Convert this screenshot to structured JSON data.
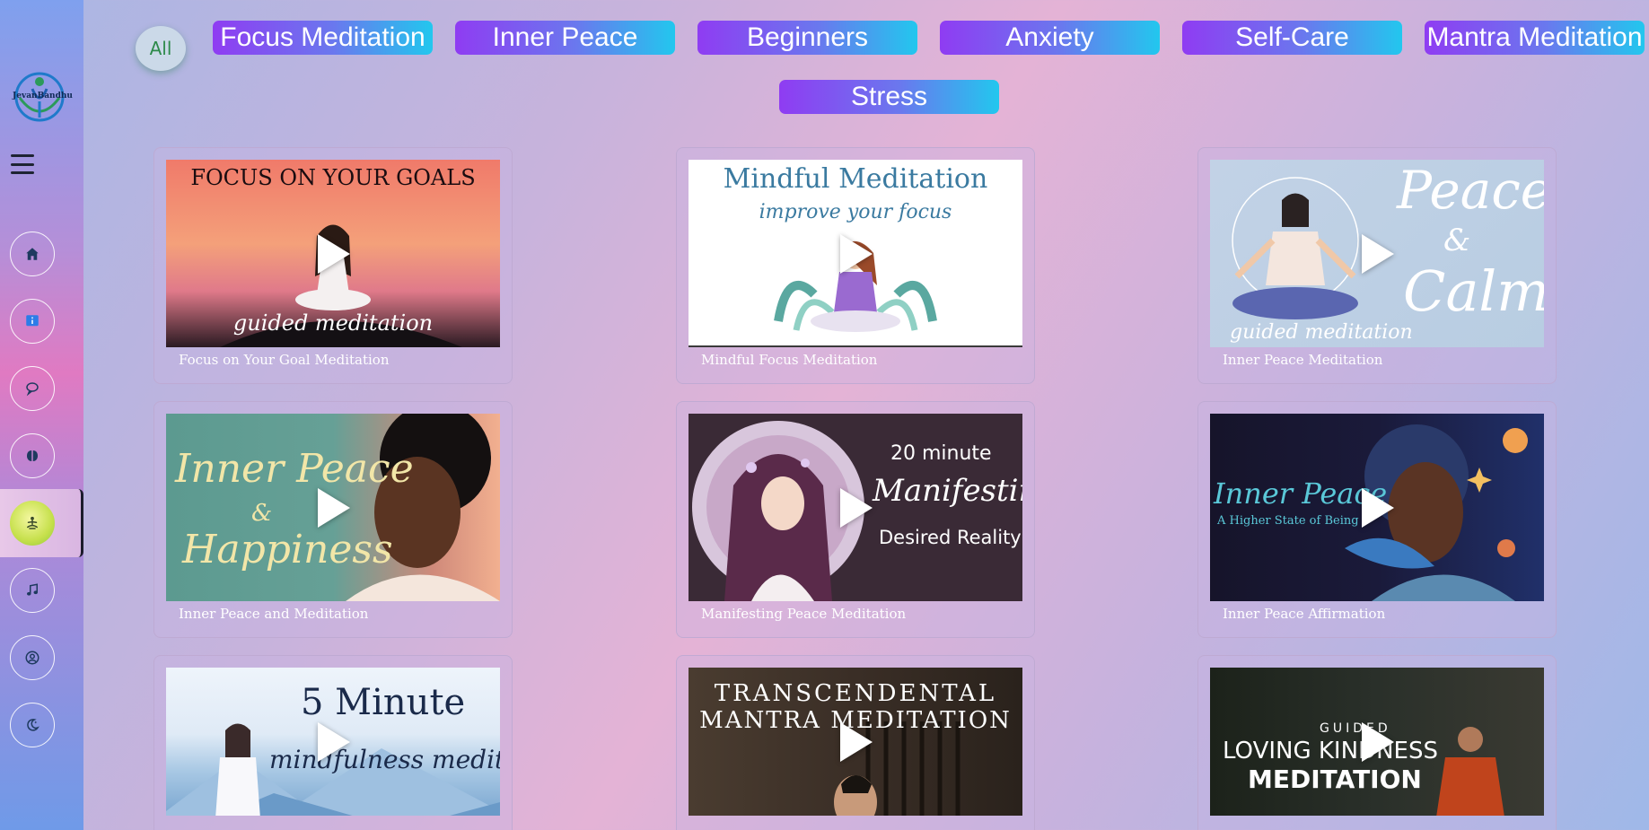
{
  "sidebar": {
    "logo_text": "JevanBandhu",
    "nav": [
      {
        "name": "home",
        "icon": "home-icon"
      },
      {
        "name": "info",
        "icon": "info-icon"
      },
      {
        "name": "chat",
        "icon": "chat-bubble-icon"
      },
      {
        "name": "brain",
        "icon": "brain-icon"
      },
      {
        "name": "meditation",
        "icon": "meditation-icon",
        "active": true
      },
      {
        "name": "music",
        "icon": "music-note-icon"
      },
      {
        "name": "profile",
        "icon": "user-circle-icon"
      },
      {
        "name": "theme",
        "icon": "moon-icon"
      }
    ]
  },
  "filters": {
    "all": "All",
    "chips": [
      "Focus Meditation",
      "Inner Peace",
      "Beginners",
      "Anxiety",
      "Self-Care",
      "Mantra Meditation",
      "Stress"
    ]
  },
  "videos": [
    {
      "title": "Focus on Your Goal Meditation",
      "thumb_heading": "FOCUS ON YOUR GOALS",
      "thumb_sub": "guided meditation"
    },
    {
      "title": "Mindful Focus Meditation",
      "thumb_heading": "Mindful Meditation",
      "thumb_sub": "improve your focus"
    },
    {
      "title": "Inner Peace Meditation",
      "thumb_heading_1": "Peace",
      "thumb_heading_2": "&",
      "thumb_heading_3": "Calm",
      "thumb_sub": "guided meditation"
    },
    {
      "title": "Inner Peace and Meditation",
      "thumb_heading_1": "Inner Peace",
      "thumb_heading_2": "&",
      "thumb_heading_3": "Happiness"
    },
    {
      "title": "Manifesting Peace Meditation",
      "thumb_heading_1": "20 minute",
      "thumb_heading_2": "Manifesting",
      "thumb_heading_3": "Desired Reality"
    },
    {
      "title": "Inner Peace Affirmation",
      "thumb_heading": "Inner Peace",
      "thumb_sub": "A Higher State of Being"
    },
    {
      "title": "",
      "thumb_heading_1": "5 Minute",
      "thumb_heading_2": "mindfulness meditation"
    },
    {
      "title": "",
      "thumb_heading_1": "TRANSCENDENTAL",
      "thumb_heading_2": "MANTRA MEDITATION"
    },
    {
      "title": "",
      "thumb_heading_1": "GUIDED",
      "thumb_heading_2": "LOVING KINDNESS",
      "thumb_heading_3": "MEDITATION"
    }
  ]
}
